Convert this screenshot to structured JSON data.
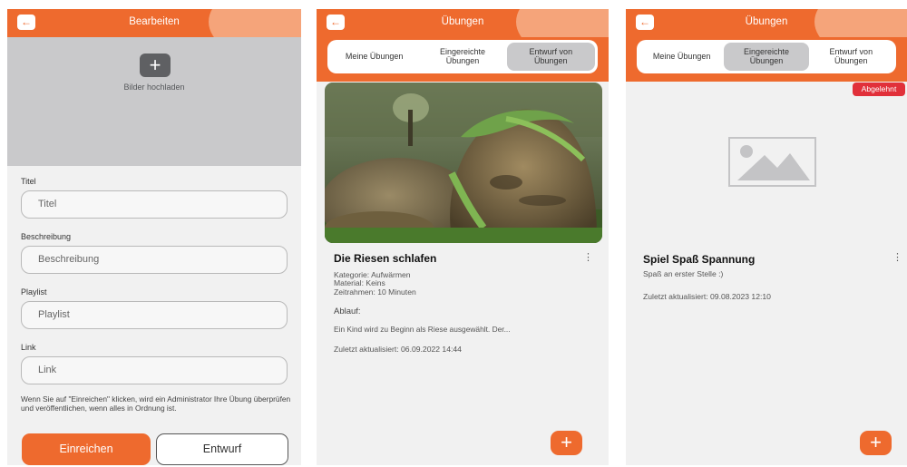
{
  "panel1": {
    "header_title": "Bearbeiten",
    "back_icon": "←",
    "upload_plus": "+",
    "upload_label": "Bilder hochladen",
    "fields": [
      {
        "label": "Titel",
        "placeholder": "Titel"
      },
      {
        "label": "Beschreibung",
        "placeholder": "Beschreibung"
      },
      {
        "label": "Playlist",
        "placeholder": "Playlist"
      },
      {
        "label": "Link",
        "placeholder": "Link"
      }
    ],
    "note": "Wenn Sie auf \"Einreichen\" klicken, wird ein Administrator Ihre Übung überprüfen und veröffentlichen, wenn alles in Ordnung ist.",
    "submit_label": "Einreichen",
    "draft_label": "Entwurf"
  },
  "panel2": {
    "header_title": "Übungen",
    "back_icon": "←",
    "tabs": [
      "Meine Übungen",
      "Eingereichte\nÜbungen",
      "Entwurf von\nÜbungen"
    ],
    "card": {
      "title": "Die Riesen schlafen",
      "kategorie": "Kategorie: Aufwärmen",
      "material": "Material: Keins",
      "zeitrahmen": "Zeitrahmen: 10 Minuten",
      "ablauf_label": "Ablauf:",
      "ablauf_text": "Ein Kind wird zu Beginn als Riese ausgewählt. Der...",
      "updated": "Zuletzt aktualisiert: 06.09.2022 14:44"
    },
    "fab_label": "+"
  },
  "panel3": {
    "header_title": "Übungen",
    "back_icon": "←",
    "tabs": [
      "Meine Übungen",
      "Eingereichte\nÜbungen",
      "Entwurf von\nÜbungen"
    ],
    "badge": "Abgelehnt",
    "card": {
      "title": "Spiel Spaß Spannung",
      "subtitle": "Spaß an erster Stelle :)",
      "updated": "Zuletzt aktualisiert: 09.08.2023 12:10"
    },
    "fab_label": "+"
  },
  "colors": {
    "accent": "#ee6a2e",
    "header_wave": "#f5a47a",
    "active_tab": "#c9c9cb",
    "badge": "#e1303a"
  }
}
